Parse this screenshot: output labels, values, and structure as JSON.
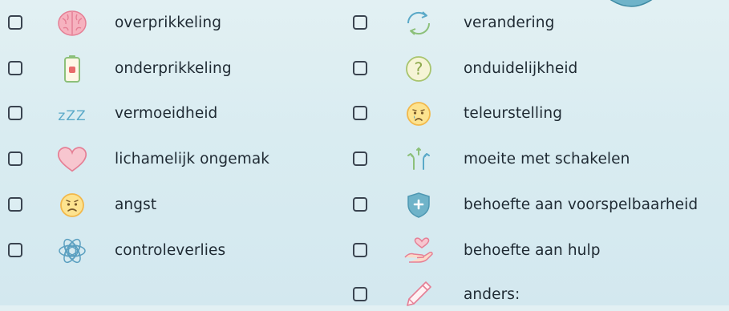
{
  "left_items": [
    {
      "label": "overprikkeling",
      "icon": "brain-icon",
      "checked": false
    },
    {
      "label": "onderprikkeling",
      "icon": "battery-low-icon",
      "checked": false
    },
    {
      "label": "vermoeidheid",
      "icon": "zzz-icon",
      "checked": false
    },
    {
      "label": "lichamelijk ongemak",
      "icon": "heart-icon",
      "checked": false
    },
    {
      "label": "angst",
      "icon": "worried-face-icon",
      "checked": false
    },
    {
      "label": "controleverlies",
      "icon": "tangle-icon",
      "checked": false
    }
  ],
  "right_items": [
    {
      "label": "verandering",
      "icon": "refresh-arrows-icon",
      "checked": false
    },
    {
      "label": "onduidelijkheid",
      "icon": "question-circle-icon",
      "checked": false
    },
    {
      "label": "teleurstelling",
      "icon": "crying-face-icon",
      "checked": false
    },
    {
      "label": "moeite met schakelen",
      "icon": "switch-arrows-icon",
      "checked": false
    },
    {
      "label": "behoefte aan voorspelbaarheid",
      "icon": "shield-icon",
      "checked": false
    },
    {
      "label": "behoefte aan hulp",
      "icon": "helping-hand-heart-icon",
      "checked": false
    },
    {
      "label": "anders:",
      "icon": "pencil-icon",
      "checked": false
    }
  ],
  "zzz_text": "zZZ",
  "question_mark": "?",
  "colors": {
    "pink": "#f4a6b4",
    "yellow": "#f7d37a",
    "green": "#8cc07a",
    "blue": "#5aa9c8",
    "teal": "#5fb0bf"
  }
}
